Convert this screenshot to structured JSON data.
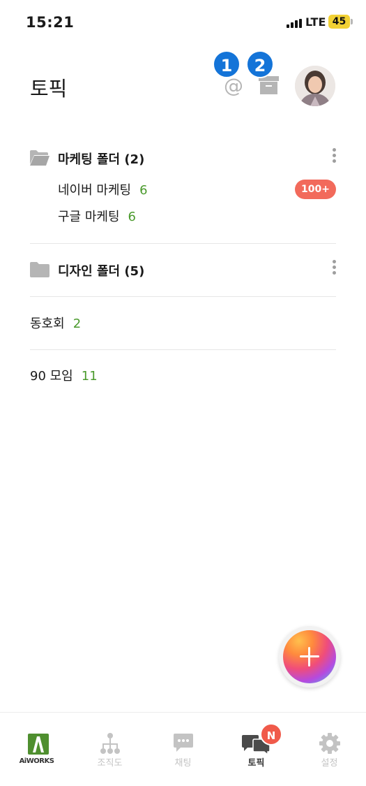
{
  "status_bar": {
    "time": "15:21",
    "network": "LTE",
    "battery": "45"
  },
  "header": {
    "title": "토픽",
    "mention_icon": "@",
    "annotations": [
      "1",
      "2"
    ]
  },
  "folders": [
    {
      "label": "마케팅 폴더 (2)",
      "expanded": true,
      "topics": [
        {
          "name": "네이버 마케팅",
          "count": "6",
          "unread": "100+"
        },
        {
          "name": "구글 마케팅",
          "count": "6"
        }
      ]
    },
    {
      "label": "디자인 폴더 (5)",
      "expanded": false
    }
  ],
  "topics": [
    {
      "name": "동호회",
      "count": "2"
    },
    {
      "name": "90 모임",
      "count": "11"
    }
  ],
  "bottom_nav": {
    "brand": "AiWORKS",
    "items": [
      {
        "label": "조직도",
        "icon": "org-chart-icon"
      },
      {
        "label": "채팅",
        "icon": "chat-icon"
      },
      {
        "label": "토픽",
        "icon": "topic-icon",
        "active": true,
        "badge": "N"
      },
      {
        "label": "설정",
        "icon": "gear-icon"
      }
    ]
  },
  "colors": {
    "accent_blue": "#1474d8",
    "count_green": "#4a9a2c",
    "unread_red": "#f26a5b",
    "nav_inactive": "#c3c3c3"
  }
}
